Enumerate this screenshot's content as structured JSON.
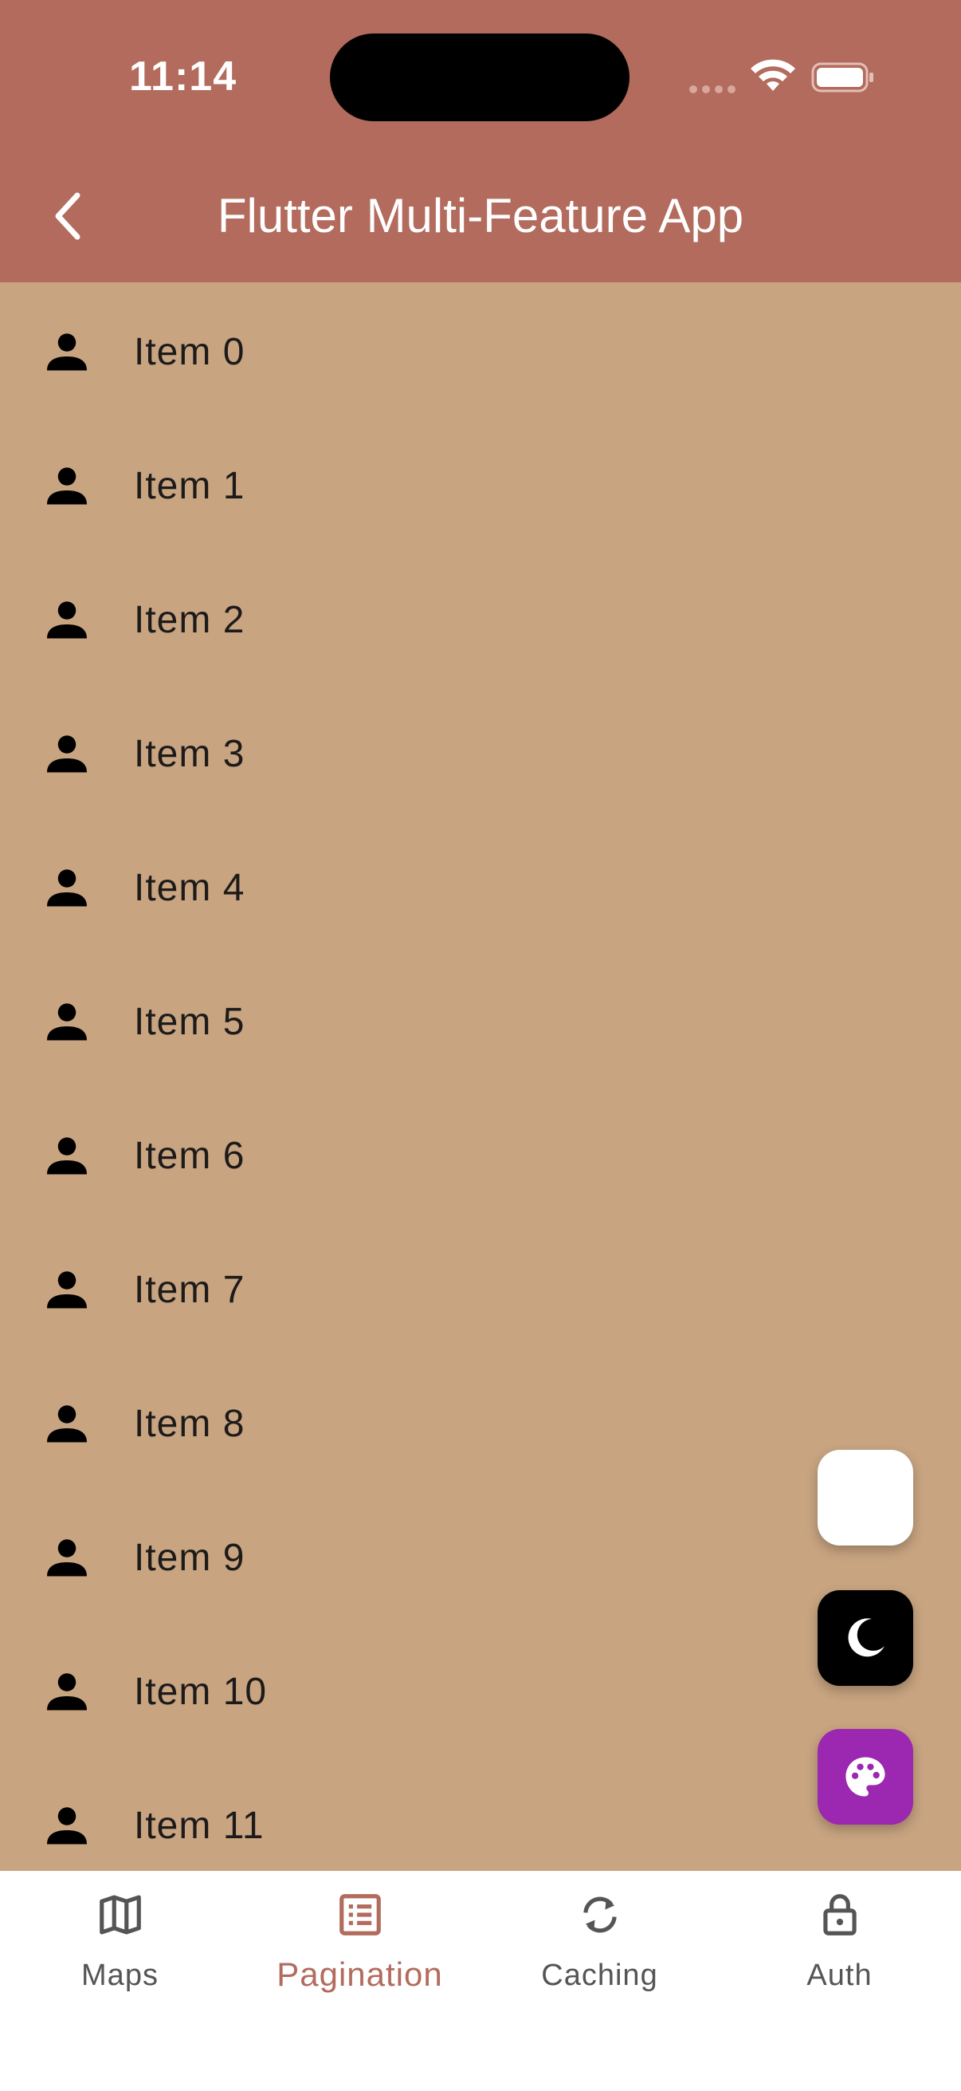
{
  "status_bar": {
    "time": "11:14"
  },
  "app_bar": {
    "title": "Flutter Multi-Feature App",
    "back_icon": "chevron-left-icon"
  },
  "list": {
    "items": [
      {
        "label": "Item 0",
        "icon": "person-icon"
      },
      {
        "label": "Item 1",
        "icon": "person-icon"
      },
      {
        "label": "Item 2",
        "icon": "person-icon"
      },
      {
        "label": "Item 3",
        "icon": "person-icon"
      },
      {
        "label": "Item 4",
        "icon": "person-icon"
      },
      {
        "label": "Item 5",
        "icon": "person-icon"
      },
      {
        "label": "Item 6",
        "icon": "person-icon"
      },
      {
        "label": "Item 7",
        "icon": "person-icon"
      },
      {
        "label": "Item 8",
        "icon": "person-icon"
      },
      {
        "label": "Item 9",
        "icon": "person-icon"
      },
      {
        "label": "Item 10",
        "icon": "person-icon"
      },
      {
        "label": "Item 11",
        "icon": "person-icon"
      }
    ]
  },
  "fabs": [
    {
      "name": "blank",
      "icon": "",
      "color": "#ffffff"
    },
    {
      "name": "dark-mode",
      "icon": "moon-icon",
      "color": "#000000"
    },
    {
      "name": "theme",
      "icon": "palette-icon",
      "color": "#9c27b0"
    }
  ],
  "bottom_nav": {
    "active_index": 1,
    "items": [
      {
        "label": "Maps",
        "icon": "map-icon"
      },
      {
        "label": "Pagination",
        "icon": "list-alt-icon"
      },
      {
        "label": "Caching",
        "icon": "sync-icon"
      },
      {
        "label": "Auth",
        "icon": "lock-icon"
      }
    ]
  },
  "colors": {
    "app_bar": "#b26b5c",
    "background": "#c8a481",
    "accent": "#b26b5c",
    "nav_inactive": "#555555"
  }
}
